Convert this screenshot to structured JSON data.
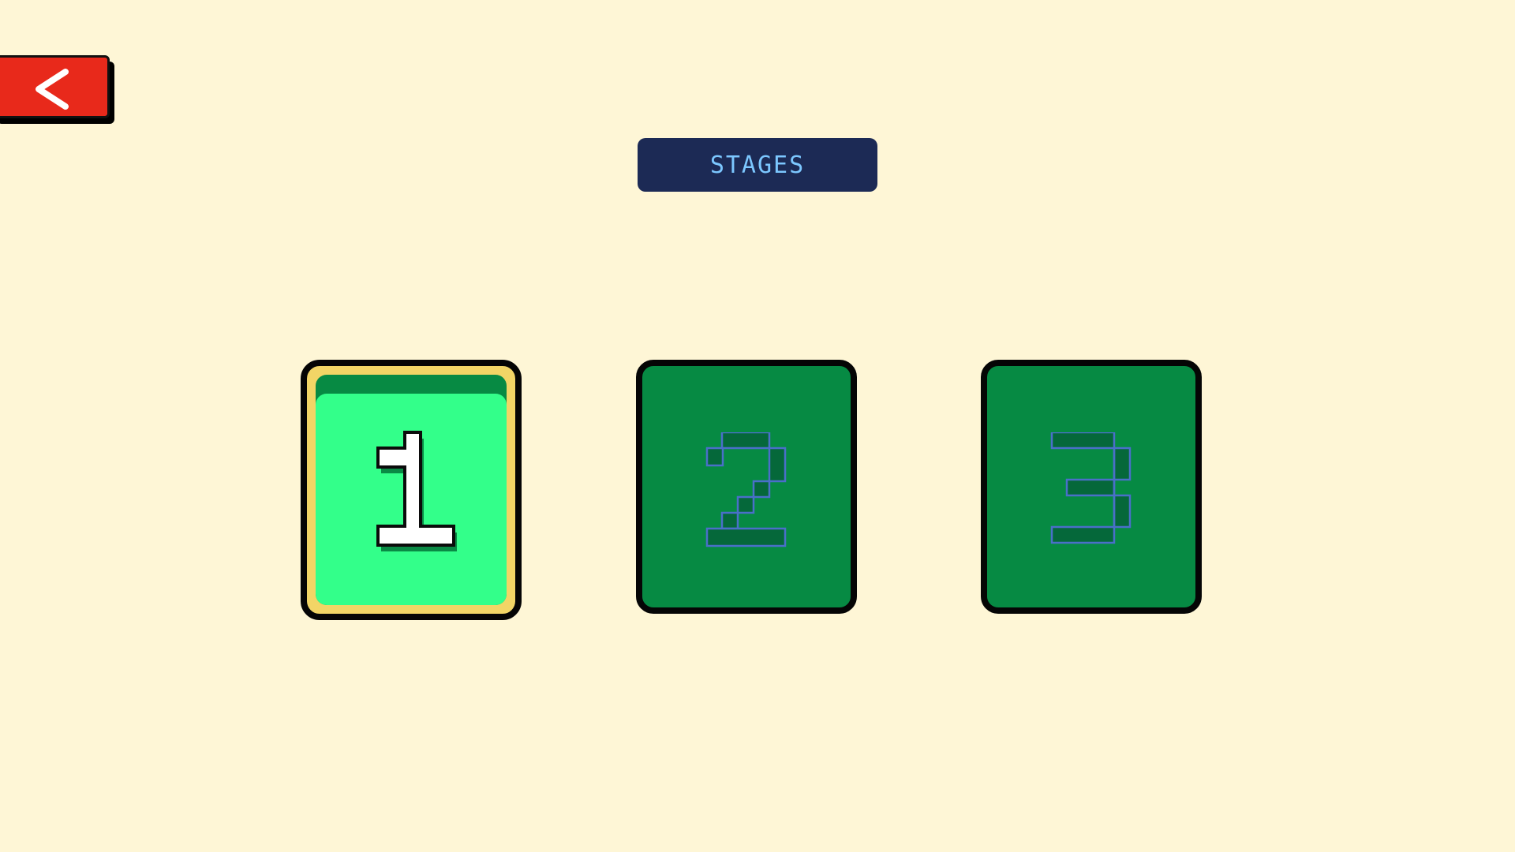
{
  "header": {
    "back_button": {
      "icon": "chevron-left-icon",
      "color": "#e8291b"
    },
    "title": "STAGES"
  },
  "stages": [
    {
      "number": "1",
      "state": "selected",
      "accent": "#33ff8a"
    },
    {
      "number": "2",
      "state": "locked",
      "accent": "#068a43"
    },
    {
      "number": "3",
      "state": "locked",
      "accent": "#068a43"
    }
  ]
}
